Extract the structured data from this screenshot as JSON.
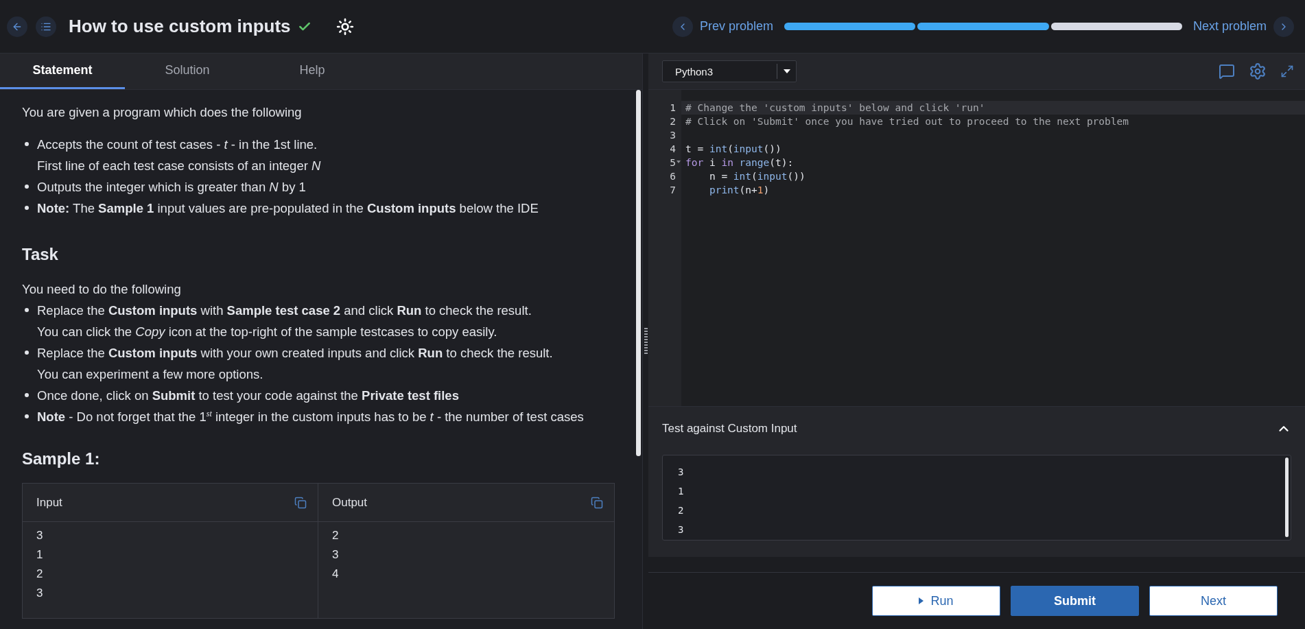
{
  "header": {
    "title": "How to use custom inputs",
    "solved": true,
    "prev_label": "Prev problem",
    "next_label": "Next problem",
    "progress": [
      {
        "done": true
      },
      {
        "done": true
      },
      {
        "done": false
      }
    ]
  },
  "tabs": [
    {
      "label": "Statement",
      "selected": true
    },
    {
      "label": "Solution",
      "selected": false
    },
    {
      "label": "Help",
      "selected": false
    }
  ],
  "statement": {
    "intro": "You are given a program which does the following",
    "bullets": [
      {
        "text": "Accepts the count of test cases - *t* - in the 1st line.",
        "continuation": "First line of each test case consists of an integer *N*"
      },
      {
        "text": "Outputs the integer which is greater than *N* by 1"
      },
      {
        "text": "**Note:** The **Sample 1** input values are pre-populated in the **Custom inputs** below the IDE"
      }
    ],
    "task_heading": "Task",
    "task_intro": "You need to do the following",
    "task_bullets": [
      {
        "text": "Replace the **Custom inputs** with **Sample test case 2** and click **Run** to check the result.",
        "continuation": "You can click the *Copy* icon at the top-right of the sample testcases to copy easily."
      },
      {
        "text": "Replace the **Custom inputs** with your own created inputs and click **Run** to check the result.",
        "continuation": "You can experiment a few more options."
      },
      {
        "text": "Once done, click on **Submit** to test your code against the **Private test files**"
      },
      {
        "text": "**Note** - Do not forget that the 1$^{st}$ integer in the custom inputs has to be *t* - the number of test cases"
      }
    ],
    "sample_heading": "Sample 1:",
    "sample_table": {
      "columns": [
        {
          "header": "Input",
          "lines": [
            "3",
            "1",
            "2",
            "3"
          ]
        },
        {
          "header": "Output",
          "lines": [
            "2",
            "3",
            "4"
          ]
        }
      ]
    }
  },
  "editor": {
    "language": "Python3",
    "lines": [
      {
        "number": "1",
        "active": true,
        "foldable": false,
        "tokens": [
          {
            "kind": "comment",
            "text": "# Change the 'custom inputs' below and click 'run'"
          }
        ]
      },
      {
        "number": "2",
        "active": false,
        "foldable": false,
        "tokens": [
          {
            "kind": "comment",
            "text": "# Click on 'Submit' once you have tried out to proceed to the next problem"
          }
        ]
      },
      {
        "number": "3",
        "active": false,
        "foldable": false
      },
      {
        "number": "4",
        "active": false,
        "foldable": false,
        "tokens": [
          {
            "kind": "plain",
            "text": "t = "
          },
          {
            "kind": "builtin",
            "text": "int"
          },
          {
            "kind": "plain",
            "text": "("
          },
          {
            "kind": "builtin",
            "text": "input"
          },
          {
            "kind": "plain",
            "text": "())"
          }
        ]
      },
      {
        "number": "5",
        "active": false,
        "foldable": true,
        "tokens": [
          {
            "kind": "keyword",
            "text": "for"
          },
          {
            "kind": "plain",
            "text": " i "
          },
          {
            "kind": "keyword",
            "text": "in"
          },
          {
            "kind": "builtin",
            "text": " range"
          },
          {
            "kind": "plain",
            "text": "(t):"
          }
        ]
      },
      {
        "number": "6",
        "active": false,
        "foldable": false,
        "tokens": [
          {
            "kind": "plain",
            "text": "    n = "
          },
          {
            "kind": "builtin",
            "text": "int"
          },
          {
            "kind": "plain",
            "text": "("
          },
          {
            "kind": "builtin",
            "text": "input"
          },
          {
            "kind": "plain",
            "text": "())"
          }
        ]
      },
      {
        "number": "7",
        "active": false,
        "foldable": false,
        "tokens": [
          {
            "kind": "builtin",
            "text": "    print"
          },
          {
            "kind": "plain",
            "text": "(n+"
          },
          {
            "kind": "number",
            "text": "1"
          },
          {
            "kind": "plain",
            "text": ")"
          }
        ]
      }
    ]
  },
  "custom_input": {
    "title": "Test against Custom Input",
    "expanded": true,
    "lines": [
      "3",
      "1",
      "2",
      "3"
    ]
  },
  "buttons": [
    {
      "kind": "run",
      "label": "Run"
    },
    {
      "kind": "submit",
      "label": "Submit"
    },
    {
      "kind": "next",
      "label": "Next"
    }
  ]
}
